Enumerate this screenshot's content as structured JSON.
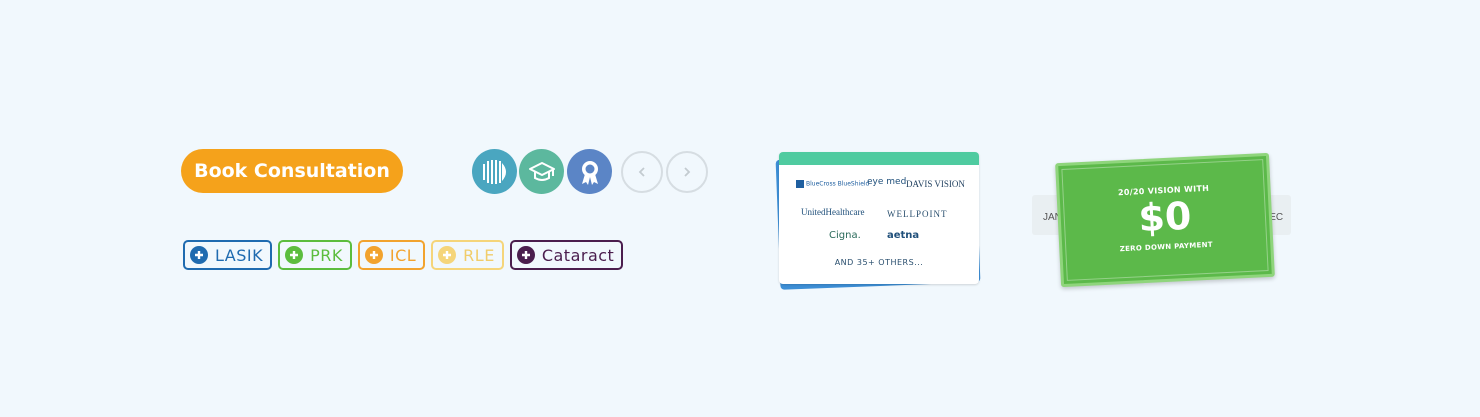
{
  "book_button": {
    "label": "Book Consultation"
  },
  "nav": {
    "prev_icon": "chevron-left-icon",
    "next_icon": "chevron-right-icon"
  },
  "icons": [
    {
      "name": "lines-logo-icon",
      "color": "#4aa6c0"
    },
    {
      "name": "graduation-cap-icon",
      "color": "#5cb89e"
    },
    {
      "name": "award-badge-icon",
      "color": "#5b85c6"
    }
  ],
  "tags": [
    {
      "label": "LASIK",
      "color": "#1f6bb0"
    },
    {
      "label": "PRK",
      "color": "#5cbd3e"
    },
    {
      "label": "ICL",
      "color": "#f2a32e"
    },
    {
      "label": "RLE",
      "color": "#f5d57a"
    },
    {
      "label": "Cataract",
      "color": "#4b1e4e"
    }
  ],
  "insurance": {
    "logos": [
      "BlueCross BlueShield",
      "eye med",
      "DAVIS VISION",
      "UnitedHealthcare",
      "WELLPOINT",
      "Cigna.",
      "aetna"
    ],
    "others": "AND 35+ OTHERS..."
  },
  "financing": {
    "headline": "20/20 VISION WITH",
    "amount": "$0",
    "subline": "ZERO DOWN PAYMENT",
    "strip_left": "JAN",
    "strip_right": "DEC"
  },
  "colors": {
    "accent": "#f5a21b",
    "background": "#f1f8fd",
    "money_green": "#5cb94a",
    "card_blue": "#3d8fd6",
    "card_teal": "#4fcba0"
  }
}
